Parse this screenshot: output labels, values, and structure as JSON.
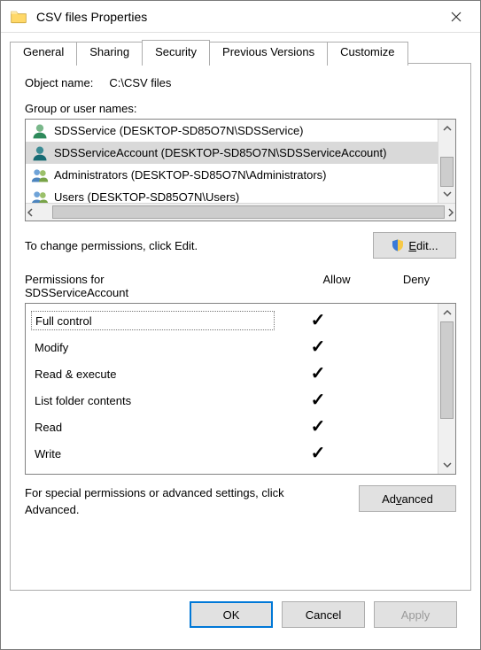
{
  "window": {
    "title": "CSV files Properties"
  },
  "tabs": [
    "General",
    "Sharing",
    "Security",
    "Previous Versions",
    "Customize"
  ],
  "active_tab": "Security",
  "object": {
    "label": "Object name:",
    "value": "C:\\CSV files"
  },
  "group_label": "Group or user names:",
  "principals": [
    {
      "name": "SDSService (DESKTOP-SD85O7N\\SDSService)",
      "type": "user",
      "selected": false
    },
    {
      "name": "SDSServiceAccount (DESKTOP-SD85O7N\\SDSServiceAccount)",
      "type": "user",
      "selected": true
    },
    {
      "name": "Administrators (DESKTOP-SD85O7N\\Administrators)",
      "type": "group",
      "selected": false
    },
    {
      "name": "Users (DESKTOP-SD85O7N\\Users)",
      "type": "group",
      "selected": false
    }
  ],
  "change_hint": "To change permissions, click Edit.",
  "edit_label": "Edit...",
  "perm_for_label": "Permissions for",
  "perm_for_principal": "SDSServiceAccount",
  "allow_label": "Allow",
  "deny_label": "Deny",
  "permissions": [
    {
      "name": "Full control",
      "allow": true,
      "deny": false
    },
    {
      "name": "Modify",
      "allow": true,
      "deny": false
    },
    {
      "name": "Read & execute",
      "allow": true,
      "deny": false
    },
    {
      "name": "List folder contents",
      "allow": true,
      "deny": false
    },
    {
      "name": "Read",
      "allow": true,
      "deny": false
    },
    {
      "name": "Write",
      "allow": true,
      "deny": false
    }
  ],
  "advanced_hint": "For special permissions or advanced settings, click Advanced.",
  "advanced_label": "Advanced",
  "buttons": {
    "ok": "OK",
    "cancel": "Cancel",
    "apply": "Apply"
  }
}
